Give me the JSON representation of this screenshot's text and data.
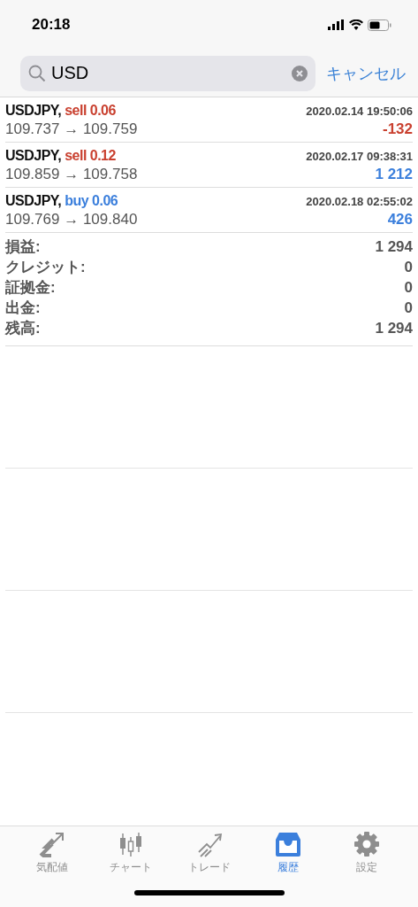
{
  "status_bar": {
    "time": "20:18"
  },
  "search": {
    "value": "USD",
    "cancel": "キャンセル"
  },
  "trades": [
    {
      "symbol": "USDJPY,",
      "order": {
        "text": "sell 0.06",
        "color": "#c9402f"
      },
      "time": "2020.02.14 19:50:06",
      "prices": "109.737 → 109.759",
      "profit": {
        "text": "-132",
        "color": "#c9402f"
      }
    },
    {
      "symbol": "USDJPY,",
      "order": {
        "text": "sell 0.12",
        "color": "#c9402f"
      },
      "time": "2020.02.17 09:38:31",
      "prices": "109.859 → 109.758",
      "profit": {
        "text": "1 212",
        "color": "#3b7fdc"
      }
    },
    {
      "symbol": "USDJPY,",
      "order": {
        "text": "buy 0.06",
        "color": "#3b7fdc"
      },
      "time": "2020.02.18 02:55:02",
      "prices": "109.769 → 109.840",
      "profit": {
        "text": "426",
        "color": "#3b7fdc"
      }
    }
  ],
  "summary": [
    {
      "label": "損益:",
      "value": "1 294"
    },
    {
      "label": "クレジット:",
      "value": "0"
    },
    {
      "label": "証拠金:",
      "value": "0"
    },
    {
      "label": "出金:",
      "value": "0"
    },
    {
      "label": "残高:",
      "value": "1 294"
    }
  ],
  "tab_bar": [
    {
      "label": "気配値",
      "selected": false
    },
    {
      "label": "チャート",
      "selected": false
    },
    {
      "label": "トレード",
      "selected": false
    },
    {
      "label": "履歴",
      "selected": true
    },
    {
      "label": "設定",
      "selected": false
    }
  ]
}
